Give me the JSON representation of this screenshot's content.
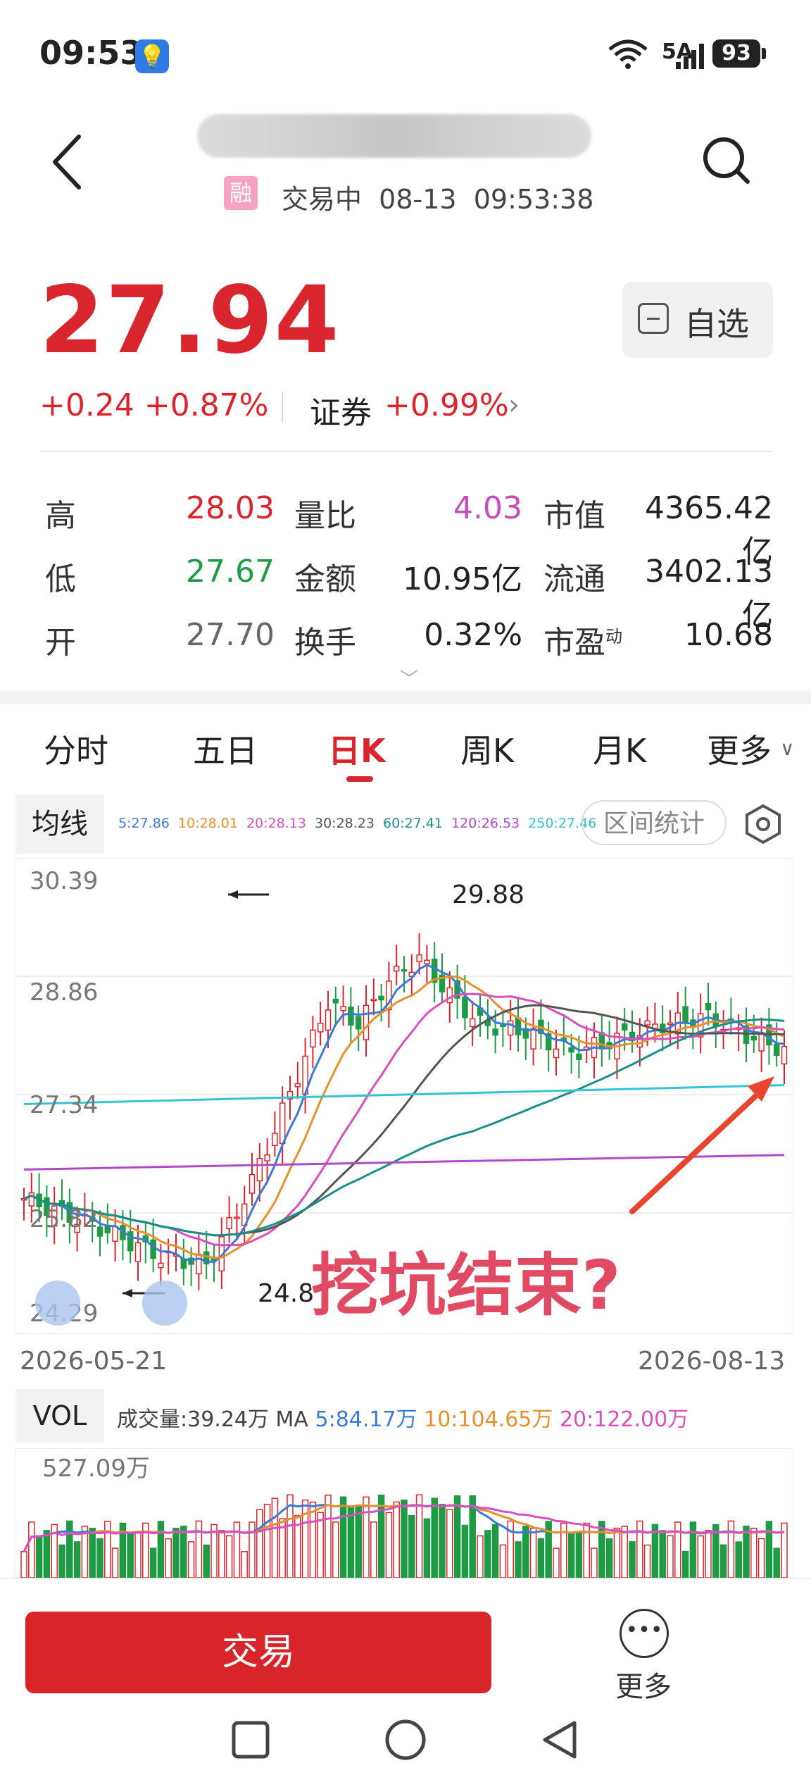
{
  "status_bar": {
    "time": "09:53",
    "network": "5A",
    "battery": "93"
  },
  "header": {
    "margin_badge": "融",
    "trade_status": "交易中  08-13  09:53:38"
  },
  "quote": {
    "price": "27.94",
    "change": "+0.24 +0.87%",
    "sector_name": "证券",
    "sector_change": "+0.99%",
    "watch_label": "自选"
  },
  "stats": {
    "high_label": "高",
    "high": "28.03",
    "low_label": "低",
    "low": "27.67",
    "open_label": "开",
    "open": "27.70",
    "vol_ratio_label": "量比",
    "vol_ratio": "4.03",
    "amount_label": "金额",
    "amount": "10.95亿",
    "turnover_label": "换手",
    "turnover": "0.32%",
    "mktcap_label": "市值",
    "mktcap": "4365.42亿",
    "float_label": "流通",
    "float_cap": "3402.13亿",
    "pe_label": "市盈",
    "pe_sup": "动",
    "pe": "10.68"
  },
  "tabs": [
    "分时",
    "五日",
    "日K",
    "周K",
    "月K",
    "更多"
  ],
  "ma": {
    "tag": "均线",
    "values": [
      {
        "text": "5:27.86",
        "color": "#3a7bd5"
      },
      {
        "text": "10:28.01",
        "color": "#e8902c"
      },
      {
        "text": "20:28.13",
        "color": "#d94fc2"
      },
      {
        "text": "30:28.23",
        "color": "#555555"
      },
      {
        "text": "60:27.41",
        "color": "#1a8f8a"
      },
      {
        "text": "120:26.53",
        "color": "#b04ac4"
      },
      {
        "text": "250:27.46",
        "color": "#36c3d6"
      }
    ],
    "range_btn": "区间统计"
  },
  "chart_data": {
    "type": "candlestick",
    "y_ticks": [
      "30.39",
      "28.86",
      "27.34",
      "25.82",
      "24.29"
    ],
    "ylim": [
      24.29,
      30.39
    ],
    "x_start": "2026-05-21",
    "x_end": "2026-08-13",
    "max_label": "29.88",
    "min_label": "24.8",
    "annotation": "挖坑结束?",
    "series_colors": {
      "up": "#d9262e",
      "down": "#1e9b44"
    }
  },
  "vol": {
    "tag": "VOL",
    "total": "成交量:39.24万",
    "ma_prefix": "MA",
    "ma5": "5:84.17万",
    "ma10": "10:104.65万",
    "ma20": "20:122.00万",
    "max_label": "527.09万"
  },
  "bottom": {
    "trade": "交易",
    "more": "更多"
  }
}
